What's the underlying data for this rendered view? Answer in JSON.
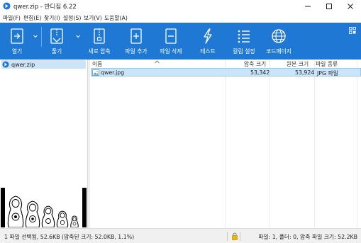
{
  "window": {
    "title": "qwer.zip - 반디집 6.22",
    "controls": [
      "minimize-icon",
      "maximize-icon",
      "close-icon"
    ]
  },
  "menu": [
    "파일(F)",
    "편집(E)",
    "찾기(I)",
    "설정(S)",
    "보기(V)",
    "도움말(A)"
  ],
  "toolbar": {
    "background": "#1e78d4",
    "buttons": [
      {
        "label": "열기",
        "icon": "open-icon",
        "has_dropdown": true
      },
      {
        "label": "풀기",
        "icon": "extract-icon",
        "has_dropdown": true
      },
      {
        "label": "새로 압축",
        "icon": "new-archive-icon",
        "has_dropdown": false
      },
      {
        "label": "파일 추가",
        "icon": "add-file-icon",
        "has_dropdown": false
      },
      {
        "label": "파일 삭제",
        "icon": "delete-file-icon",
        "has_dropdown": false
      },
      {
        "label": "테스트",
        "icon": "test-icon",
        "has_dropdown": false
      },
      {
        "label": "칼럼 설정",
        "icon": "column-settings-icon",
        "has_dropdown": false
      },
      {
        "label": "코드페이지",
        "icon": "codepage-icon",
        "has_dropdown": false
      }
    ]
  },
  "tree": {
    "items": [
      {
        "label": "qwer.zip",
        "icon": "archive-icon"
      }
    ]
  },
  "file_list": {
    "columns": [
      "이름",
      "압축 크기",
      "원본 크기",
      "파일 종류"
    ],
    "rows": [
      {
        "name": "qwer.jpg",
        "compressed": "53,342",
        "original": "53,924",
        "type": "JPG 파일",
        "icon": "image-file-icon"
      }
    ]
  },
  "status": {
    "left": "1 파일 선택됨, 52.6KB (압축된 크기: 52.0KB, 1.1%)",
    "right": "파일: 1, 폴더: 0, 압축 파일 크기: 52.2KB"
  }
}
